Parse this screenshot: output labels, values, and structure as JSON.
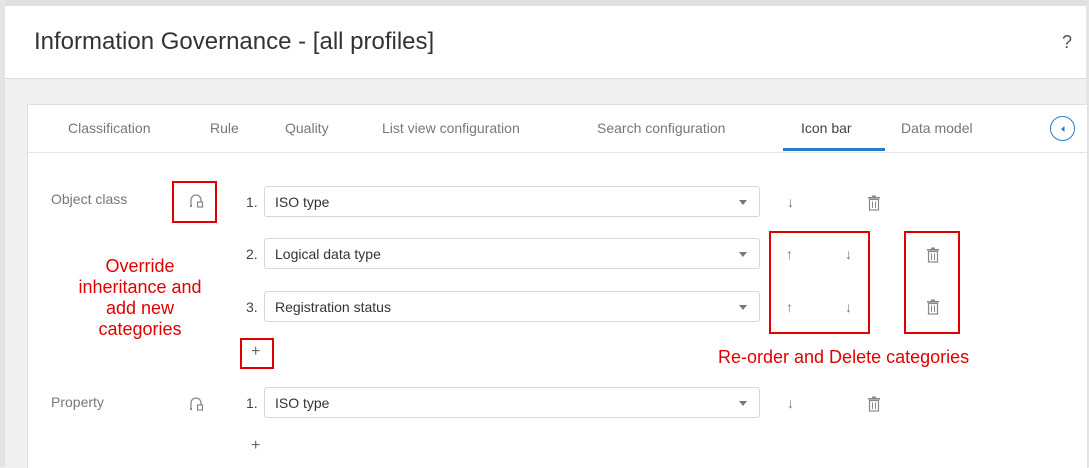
{
  "header": {
    "title": "Information Governance - [all profiles]",
    "help_label": "?"
  },
  "tabs": [
    {
      "label": "Classification"
    },
    {
      "label": "Rule"
    },
    {
      "label": "Quality"
    },
    {
      "label": "List view configuration"
    },
    {
      "label": "Search configuration"
    },
    {
      "label": "Icon bar",
      "active": true
    },
    {
      "label": "Data model"
    }
  ],
  "object_class": {
    "label": "Object class",
    "rows": [
      {
        "num": "1.",
        "value": "ISO type"
      },
      {
        "num": "2.",
        "value": "Logical data type"
      },
      {
        "num": "3.",
        "value": "Registration status"
      }
    ],
    "add_label": "+"
  },
  "property": {
    "label": "Property",
    "rows": [
      {
        "num": "1.",
        "value": "ISO type"
      }
    ],
    "add_label": "+"
  },
  "controls": {
    "up": "↑",
    "down": "↓"
  },
  "annotations": {
    "override": "Override inheritance and add new categories",
    "reorder": "Re-order and Delete categories"
  },
  "colors": {
    "accent": "#2a7bd0",
    "annotation": "#e00000"
  }
}
